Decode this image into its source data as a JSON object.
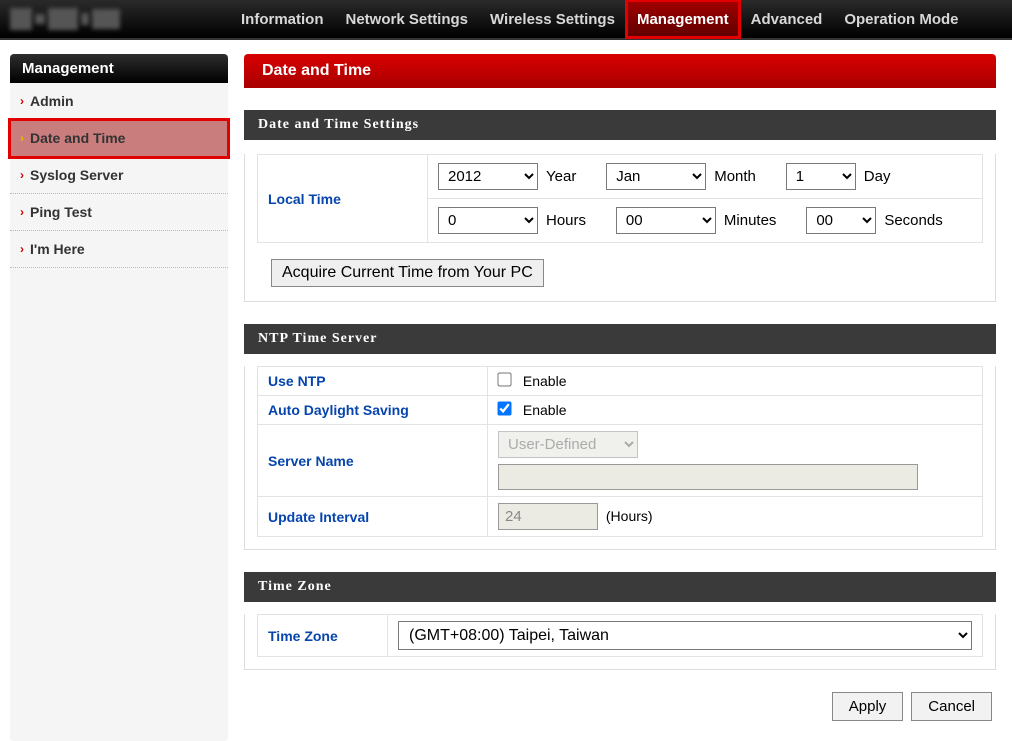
{
  "nav": {
    "items": [
      {
        "label": "Information",
        "active": false
      },
      {
        "label": "Network Settings",
        "active": false
      },
      {
        "label": "Wireless Settings",
        "active": false
      },
      {
        "label": "Management",
        "active": true
      },
      {
        "label": "Advanced",
        "active": false
      },
      {
        "label": "Operation Mode",
        "active": false
      }
    ]
  },
  "sidebar": {
    "header": "Management",
    "items": [
      {
        "label": "Admin",
        "active": false
      },
      {
        "label": "Date and Time",
        "active": true
      },
      {
        "label": "Syslog Server",
        "active": false
      },
      {
        "label": "Ping Test",
        "active": false
      },
      {
        "label": "I'm Here",
        "active": false
      }
    ]
  },
  "page": {
    "title": "Date and Time"
  },
  "datetime": {
    "section_title": "Date and Time Settings",
    "local_time_label": "Local Time",
    "year_value": "2012",
    "year_label": "Year",
    "month_value": "Jan",
    "month_label": "Month",
    "day_value": "1",
    "day_label": "Day",
    "hours_value": "0",
    "hours_label": "Hours",
    "minutes_value": "00",
    "minutes_label": "Minutes",
    "seconds_value": "00",
    "seconds_label": "Seconds",
    "acquire_button": "Acquire Current Time from Your PC"
  },
  "ntp": {
    "section_title": "NTP Time Server",
    "use_ntp_label": "Use NTP",
    "use_ntp_enable_text": "Enable",
    "auto_dls_label": "Auto Daylight Saving",
    "auto_dls_enable_text": "Enable",
    "server_name_label": "Server Name",
    "server_name_value": "User-Defined",
    "update_interval_label": "Update Interval",
    "update_interval_value": "24",
    "update_interval_unit": "(Hours)"
  },
  "tz": {
    "section_title": "Time Zone",
    "label": "Time Zone",
    "value": "(GMT+08:00) Taipei, Taiwan"
  },
  "buttons": {
    "apply": "Apply",
    "cancel": "Cancel"
  }
}
